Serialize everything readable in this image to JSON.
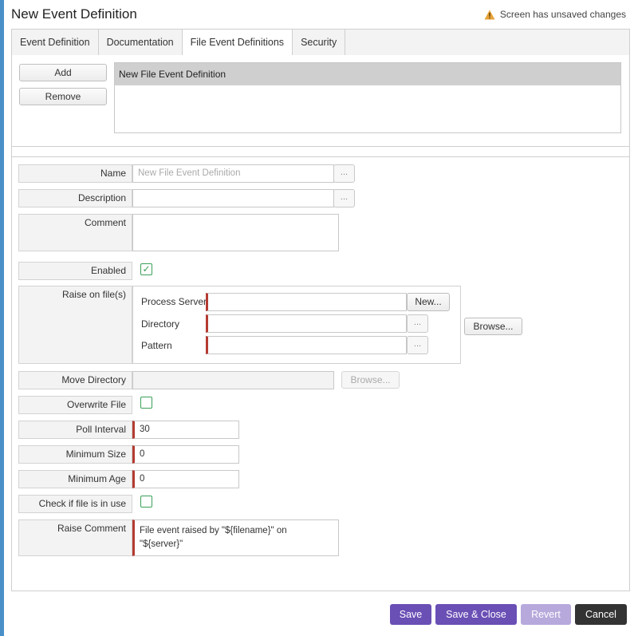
{
  "dialog": {
    "title": "New Event Definition",
    "unsaved_text": "Screen has unsaved changes"
  },
  "tabs": [
    {
      "label": "Event Definition"
    },
    {
      "label": "Documentation"
    },
    {
      "label": "File Event Definitions"
    },
    {
      "label": "Security"
    }
  ],
  "list_actions": {
    "add_label": "Add",
    "remove_label": "Remove"
  },
  "definitions_list": [
    "New File Event Definition"
  ],
  "form": {
    "name": {
      "label": "Name",
      "placeholder": "New File Event Definition"
    },
    "description": {
      "label": "Description",
      "value": ""
    },
    "comment": {
      "label": "Comment",
      "value": ""
    },
    "enabled": {
      "label": "Enabled",
      "checked": true
    },
    "raise_on_files": {
      "label": "Raise on file(s)",
      "process_server_label": "Process Server",
      "process_server_value": "",
      "new_button_label": "New...",
      "directory_label": "Directory",
      "directory_value": "",
      "pattern_label": "Pattern",
      "pattern_value": "",
      "browse_label": "Browse..."
    },
    "move_directory": {
      "label": "Move Directory",
      "value": "",
      "browse_label": "Browse..."
    },
    "overwrite_file": {
      "label": "Overwrite File",
      "checked": false
    },
    "poll_interval": {
      "label": "Poll Interval",
      "value": "30"
    },
    "minimum_size": {
      "label": "Minimum Size",
      "value": "0"
    },
    "minimum_age": {
      "label": "Minimum Age",
      "value": "0"
    },
    "check_in_use": {
      "label": "Check if file is in use",
      "checked": false
    },
    "raise_comment": {
      "label": "Raise Comment",
      "value": "File event raised by \"${filename}\" on \"${server}\""
    }
  },
  "ellipsis": "...",
  "check_glyph": "✓",
  "footer": {
    "save": "Save",
    "save_close": "Save & Close",
    "revert": "Revert",
    "cancel": "Cancel"
  },
  "colors": {
    "primary": "#6a4fb5",
    "primary_disabled": "#b7a9dc",
    "cancel": "#333333",
    "required": "#b43b32",
    "check": "#3aa05a"
  }
}
